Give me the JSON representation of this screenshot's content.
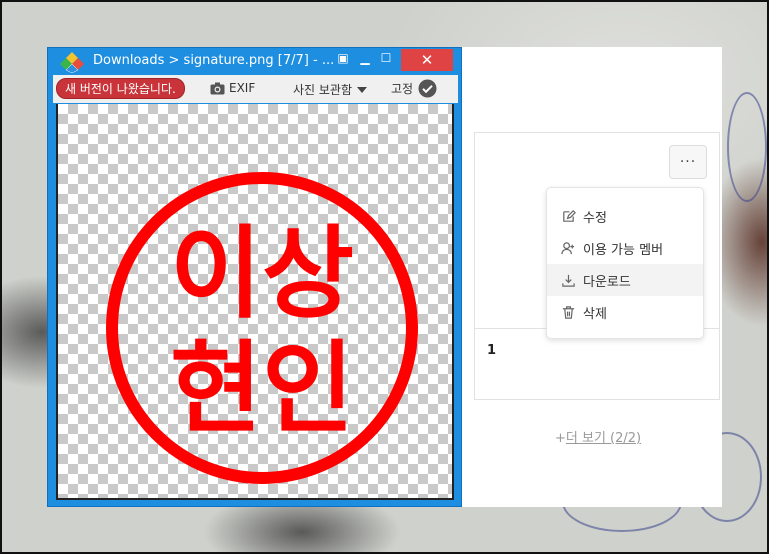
{
  "viewer": {
    "title": "Downloads  >  signature.png  [7/7]  - ...",
    "update_badge": "새 버전이 나왔습니다.",
    "exif_label": "EXIF",
    "album_label": "사진 보관함",
    "pin_label": "고정"
  },
  "stamp": {
    "line1": "이상",
    "line2": "현인",
    "color": "#ff0000"
  },
  "panel": {
    "card_value": "1",
    "more_button": "···",
    "menu": [
      {
        "icon": "edit-icon",
        "label": "수정"
      },
      {
        "icon": "add-member-icon",
        "label": "이용 가능 멤버"
      },
      {
        "icon": "download-icon",
        "label": "다운로드"
      },
      {
        "icon": "trash-icon",
        "label": "삭제"
      }
    ],
    "show_more_prefix": "+",
    "show_more": "더 보기 (2/2)"
  },
  "colors": {
    "titlebar": "#1e8fe0",
    "close": "#e04343",
    "badge": "#c8343a"
  }
}
